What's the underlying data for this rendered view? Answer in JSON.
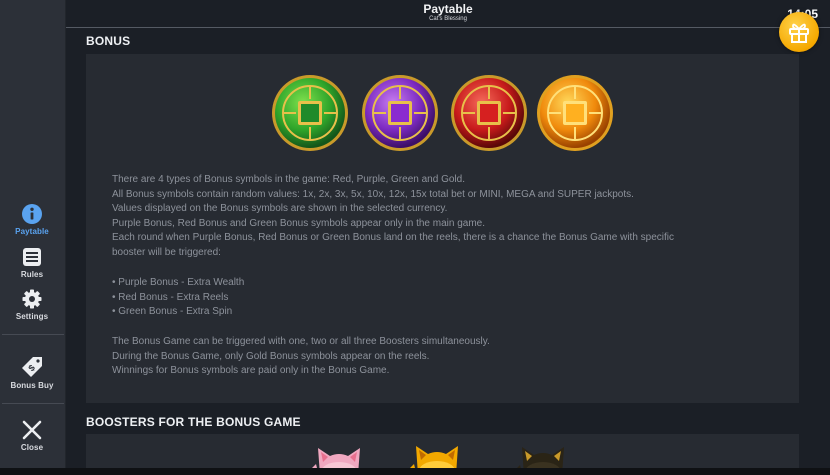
{
  "header": {
    "title": "Paytable",
    "subtitle": "Cat's Blessing",
    "clock": "14:05"
  },
  "sidebar": {
    "items": [
      {
        "label": "Paytable",
        "icon": "info-icon",
        "active": true
      },
      {
        "label": "Rules",
        "icon": "list-icon",
        "active": false
      },
      {
        "label": "Settings",
        "icon": "gear-icon",
        "active": false
      },
      {
        "label": "Bonus Buy",
        "icon": "price-tag-icon",
        "active": false
      },
      {
        "label": "Close",
        "icon": "close-icon",
        "active": false
      }
    ]
  },
  "bonus": {
    "title": "BONUS",
    "symbols": [
      {
        "color": "green",
        "hex": "#2fae2c"
      },
      {
        "color": "purple",
        "hex": "#8a2bd0"
      },
      {
        "color": "red",
        "hex": "#d62020"
      },
      {
        "color": "gold",
        "hex": "#f0920c"
      }
    ],
    "lines": [
      "There are 4 types of Bonus symbols in the game: Red, Purple, Green and Gold.",
      "All Bonus symbols contain random values: 1x, 2x, 3x, 5x, 10x, 12x, 15x total bet or MINI, MEGA and SUPER jackpots.",
      "Values displayed on the Bonus symbols are shown in the selected currency.",
      "Purple Bonus, Red Bonus and Green Bonus symbols appear only in the main game.",
      "Each round when Purple Bonus, Red Bonus or Green Bonus land on the reels, there is a chance the Bonus Game with specific",
      "booster will be triggered:"
    ],
    "boosters_list": [
      "• Purple Bonus - Extra Wealth",
      "• Red Bonus - Extra Reels",
      "• Green Bonus - Extra Spin"
    ],
    "closing_lines": [
      "The Bonus Game can be triggered with one, two or all three Boosters simultaneously.",
      "During the Bonus Game, only Gold Bonus symbols appear on the reels.",
      "Winnings for Bonus symbols are paid only in the Bonus Game."
    ]
  },
  "boosters_section": {
    "title": "BOOSTERS FOR THE BONUS GAME"
  },
  "colors": {
    "accent": "#5aa3f0",
    "panel": "#272b32",
    "background": "#1b1f26",
    "sidebar": "#2c3038",
    "text": "#8d929b"
  }
}
